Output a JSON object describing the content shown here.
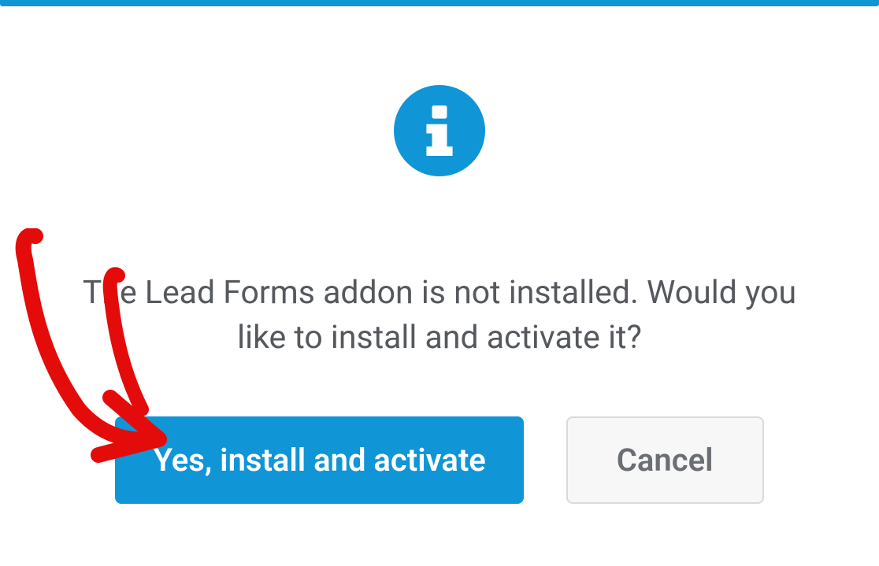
{
  "modal": {
    "message": "The Lead Forms addon is not installed. Would you like to install and activate it?",
    "confirm_label": "Yes, install and activate",
    "cancel_label": "Cancel"
  },
  "colors": {
    "accent": "#1095d6"
  }
}
